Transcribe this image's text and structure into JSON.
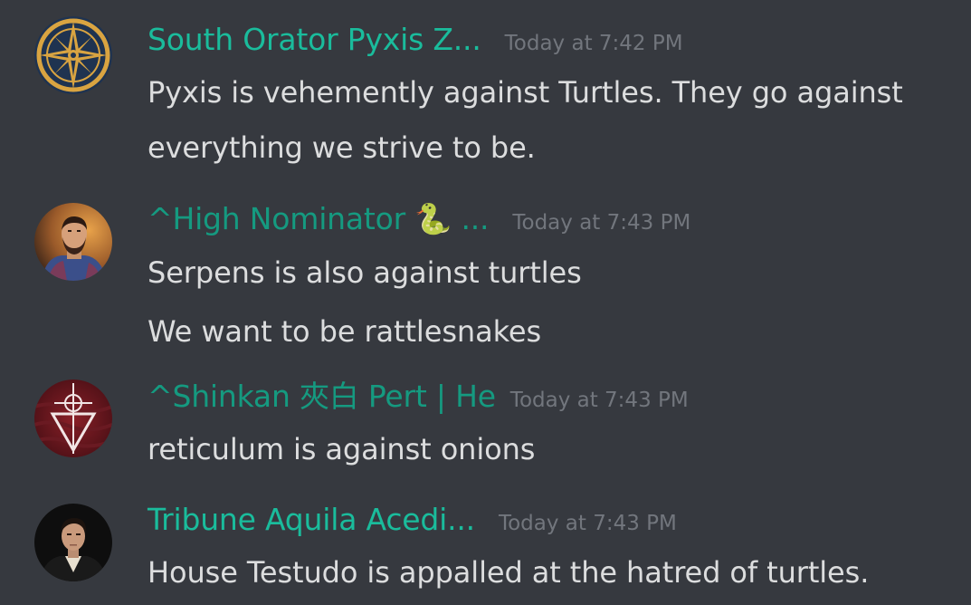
{
  "messages": [
    {
      "username": "South Orator Pyxis Z...",
      "timestamp": "Today at 7:42 PM",
      "avatar": "compass-crest-icon",
      "lines": [
        "Pyxis is vehemently against Turtles. They go against",
        "everything we strive to be."
      ]
    },
    {
      "username": "^High Nominator 🐍 ...",
      "timestamp": "Today at 7:43 PM",
      "avatar": "bearded-man-portrait",
      "lines": [
        "Serpens is also against turtles",
        "We want to be rattlesnakes"
      ]
    },
    {
      "username": "^Shinkan 夾白 Pert | He",
      "timestamp": "Today at 7:43 PM",
      "avatar": "reticle-shield-icon",
      "lines": [
        "reticulum is against onions"
      ]
    },
    {
      "username": "Tribune Aquila Acedi...",
      "timestamp": "Today at 7:43 PM",
      "avatar": "victorian-man-portrait",
      "lines": [
        "House Testudo is appalled at the hatred of turtles."
      ]
    }
  ],
  "colors": {
    "background": "#36393f",
    "username": "#1abc9c",
    "timestamp": "#72767d",
    "message_text": "#dcddde"
  }
}
